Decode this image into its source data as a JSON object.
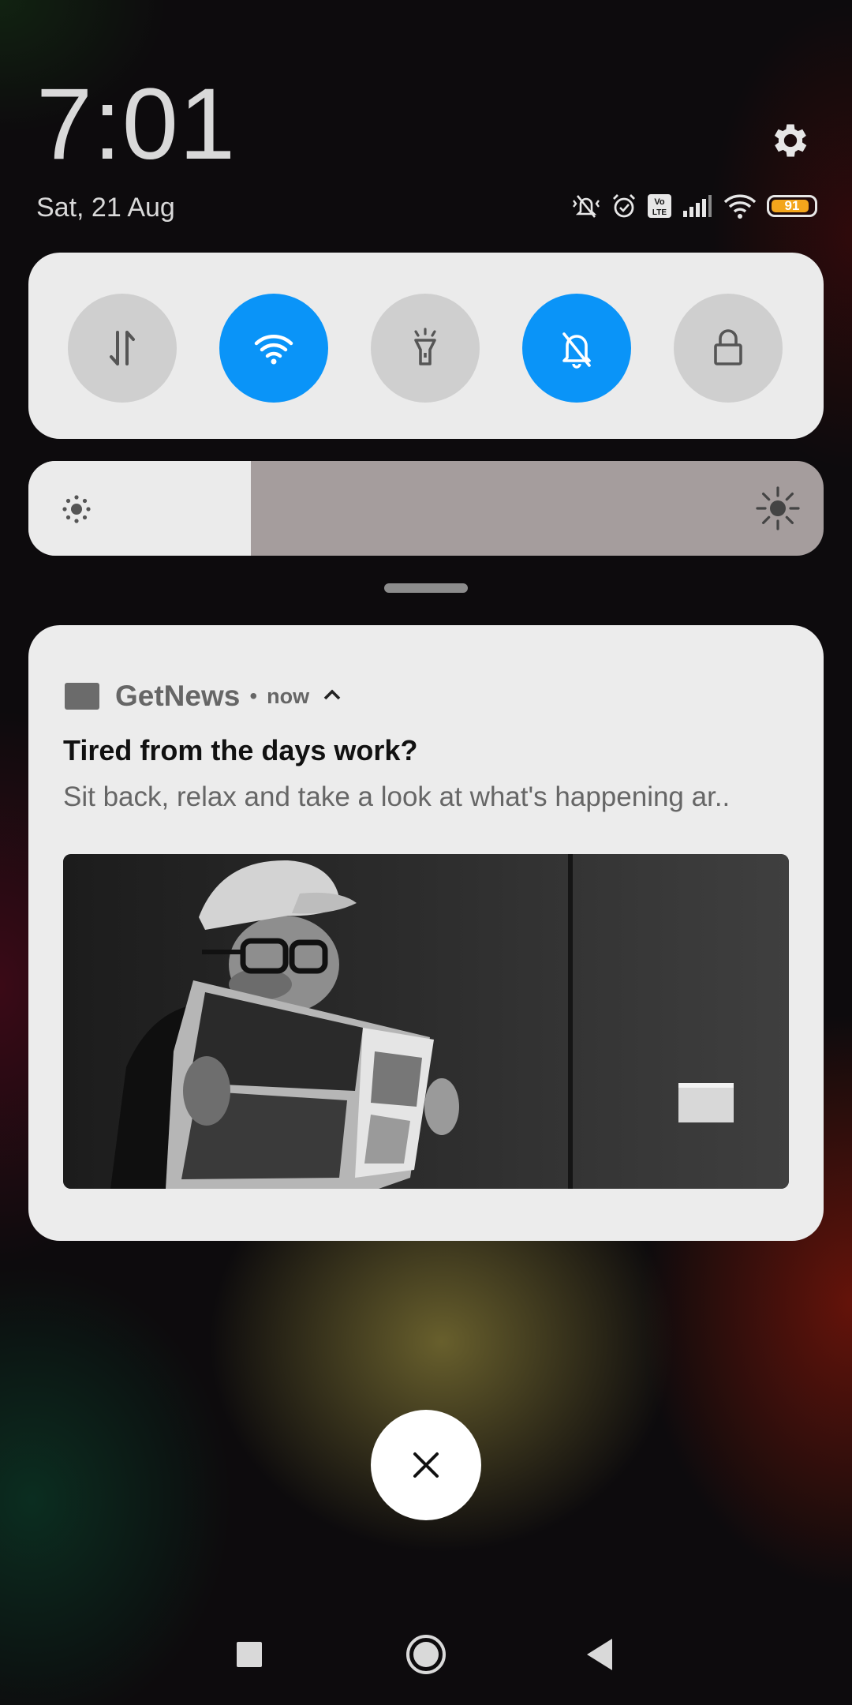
{
  "status": {
    "time": "7:01",
    "date": "Sat, 21 Aug",
    "battery_level": "91",
    "icons": [
      "vibrate-silent-icon",
      "alarm-icon",
      "volte-icon",
      "signal-icon",
      "wifi-icon",
      "battery-icon"
    ],
    "volte_top": "Vo",
    "volte_bottom": "LTE"
  },
  "quick_settings": {
    "toggles": [
      {
        "name": "mobile-data",
        "icon": "data-arrows-icon",
        "on": false
      },
      {
        "name": "wifi",
        "icon": "wifi-icon",
        "on": true
      },
      {
        "name": "flashlight",
        "icon": "flashlight-icon",
        "on": false
      },
      {
        "name": "silent",
        "icon": "bell-off-icon",
        "on": true
      },
      {
        "name": "lock-screen",
        "icon": "lock-icon",
        "on": false
      }
    ],
    "brightness_fraction": 0.28
  },
  "notification": {
    "app_name": "GetNews",
    "separator": "•",
    "time": "now",
    "title": "Tired from the days work?",
    "body": "Sit back, relax and take a look at what's happening ar..",
    "image": "man-reading-newspaper-photo"
  },
  "colors": {
    "accent": "#0a94f8",
    "battery": "#f3a51c"
  }
}
